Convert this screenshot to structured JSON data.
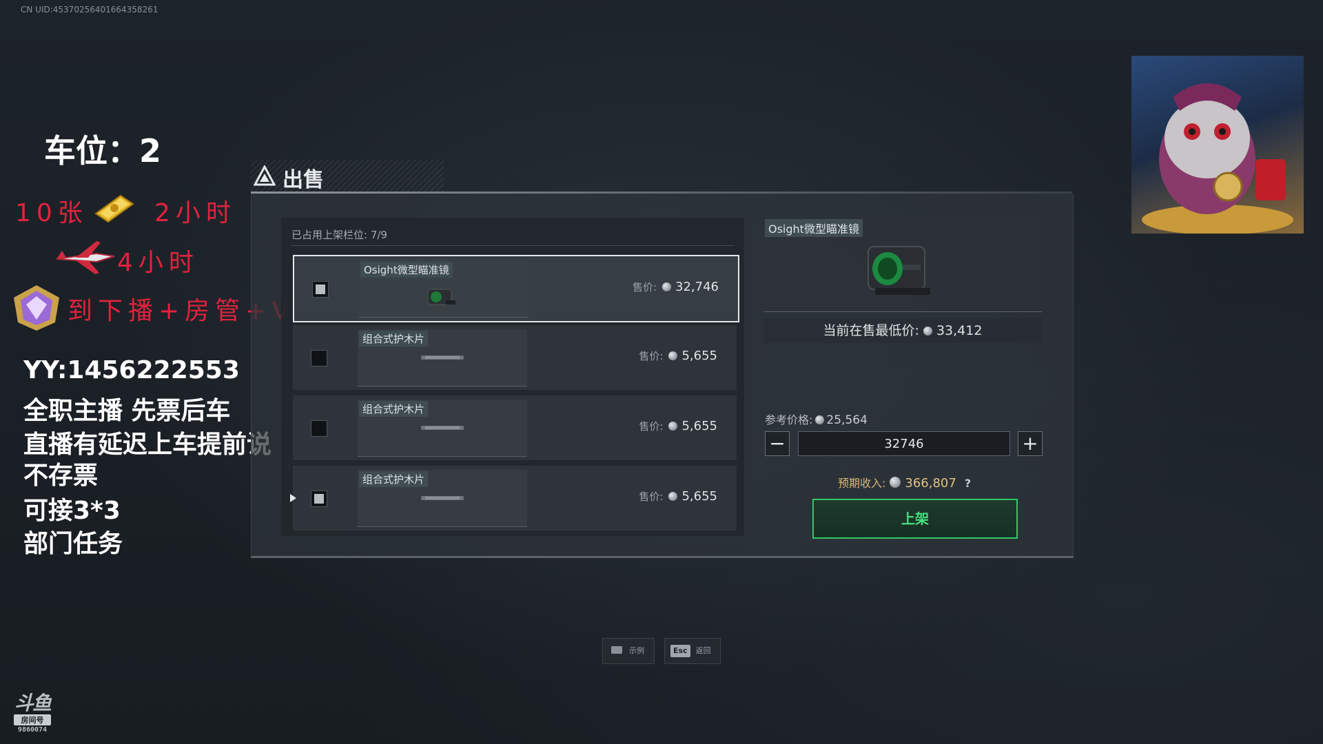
{
  "uid": "CN UID:45370256401664358261",
  "overlay": {
    "slot_title": "车位：2",
    "line1_a": "10张",
    "line1_b": "2小时",
    "line2": "4小时",
    "line3": "到下播+房管+V",
    "info": [
      "YY:1456222553",
      "全职主播 先票后车",
      "直播有延迟上车提前说",
      "不存票",
      "可接3*3",
      "部门任务"
    ]
  },
  "douyu": {
    "logo": "斗鱼",
    "room_label": "房间号",
    "room_id": "9860074"
  },
  "panel": {
    "title": "出售",
    "occupied": "已占用上架栏位: 7/9",
    "price_label": "售价:",
    "items": [
      {
        "name": "Osight微型瞄准镜",
        "price": "32,746",
        "checked": true,
        "selected": true,
        "thumb": "scope"
      },
      {
        "name": "组合式护木片",
        "price": "5,655",
        "checked": false,
        "selected": false,
        "thumb": "plate"
      },
      {
        "name": "组合式护木片",
        "price": "5,655",
        "checked": false,
        "selected": false,
        "thumb": "plate"
      },
      {
        "name": "组合式护木片",
        "price": "5,655",
        "checked": true,
        "selected": false,
        "thumb": "plate"
      }
    ]
  },
  "detail": {
    "name": "Osight微型瞄准镜",
    "lowest_label": "当前在售最低价:",
    "lowest_value": "33,412",
    "ref_label": "参考价格:",
    "ref_value": "25,564",
    "price_input": "32746",
    "income_label": "预期收入:",
    "income_value": "366,807",
    "help": "?",
    "list_button": "上架"
  },
  "footer": {
    "example": "示例",
    "esc_key": "Esc",
    "back": "返回"
  },
  "colors": {
    "accent_green": "#31c86a",
    "income_gold": "#e2c27f",
    "overlay_red": "#e2223d"
  }
}
